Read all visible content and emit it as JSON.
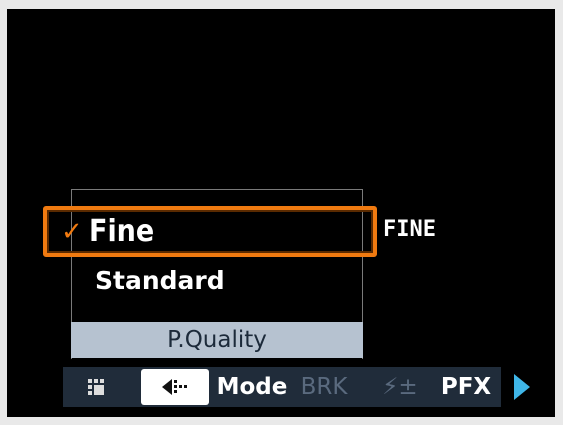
{
  "menu": {
    "items": [
      {
        "label": "Fine",
        "selected": true,
        "check_glyph": "✓"
      },
      {
        "label": "Standard",
        "selected": false
      }
    ],
    "title": "P.Quality"
  },
  "current_value": "FINE",
  "tabbar": {
    "tabs": [
      {
        "name": "grid-icon",
        "label": "",
        "active": false
      },
      {
        "name": "quality-icon",
        "label": "",
        "active": true
      },
      {
        "name": "mode",
        "label": "Mode",
        "active": false,
        "enabled": true
      },
      {
        "name": "brk",
        "label": "BRK",
        "active": false,
        "enabled": false
      },
      {
        "name": "flash-comp",
        "label": "⚡±",
        "active": false,
        "enabled": false
      },
      {
        "name": "pfx",
        "label": "PFX",
        "active": false,
        "enabled": true
      }
    ],
    "next_icon": "right-triangle-icon"
  },
  "colors": {
    "highlight": "#f07a10",
    "title_bar": "#b6c2d0",
    "tab_bar": "#202c3a",
    "disabled_text": "#5a6a7e",
    "arrow": "#3fb6e8"
  }
}
